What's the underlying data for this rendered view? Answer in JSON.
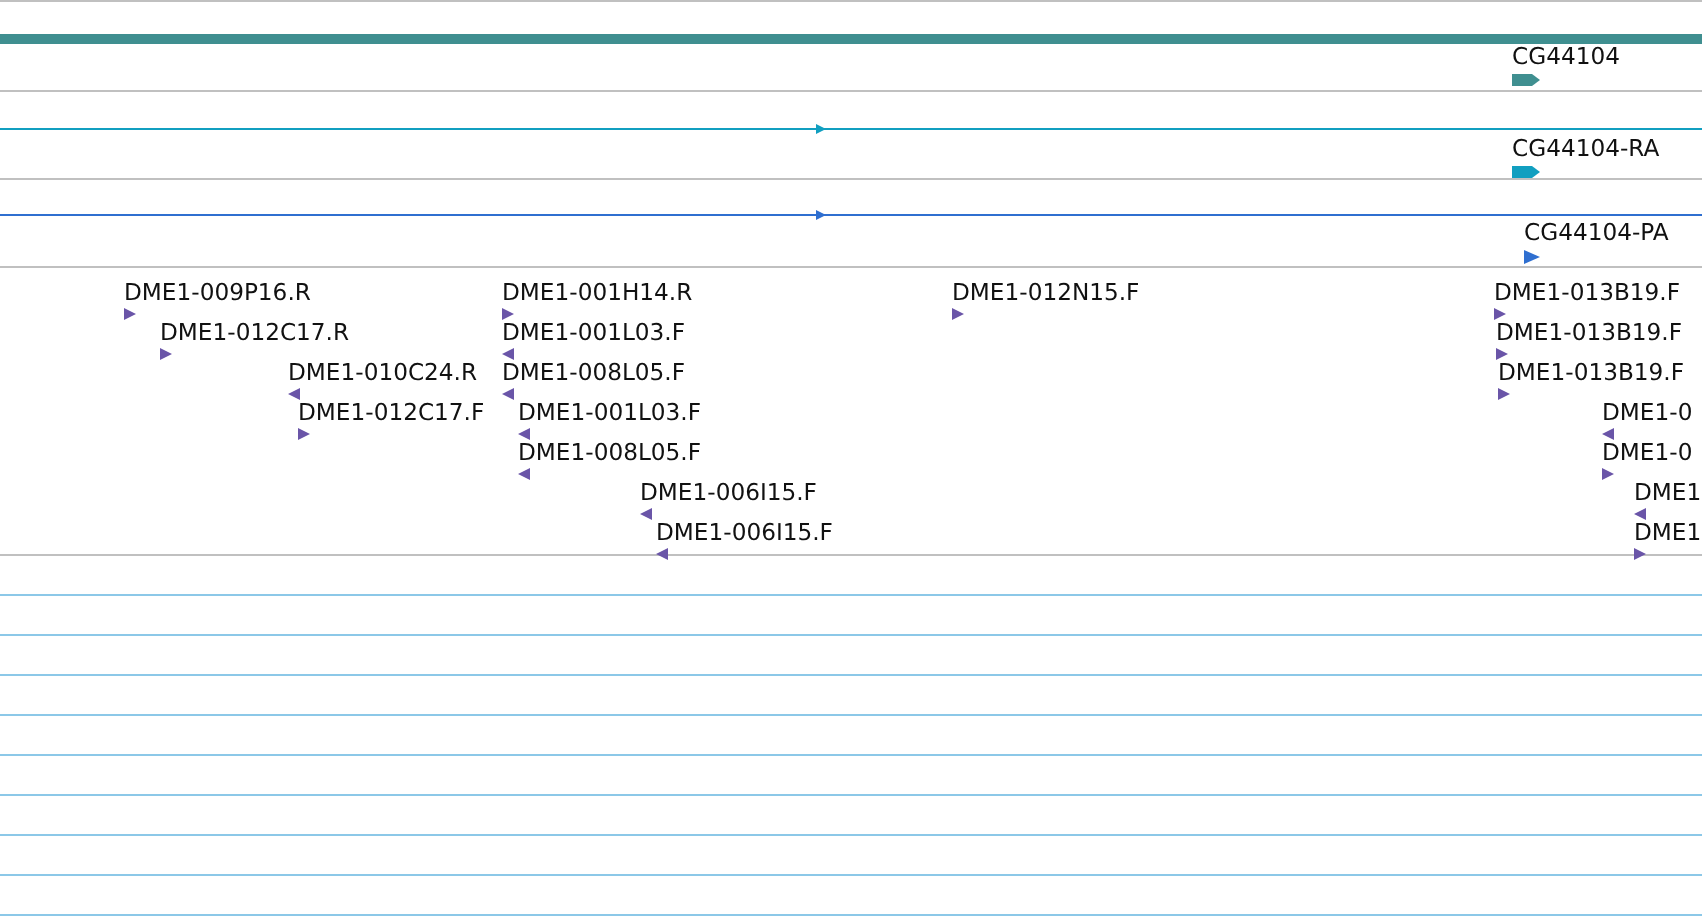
{
  "gene_tracks": [
    {
      "kind": "gene",
      "color": "#3f8f90",
      "label": "CG44104",
      "reverse": false
    },
    {
      "kind": "transcript",
      "color": "#119fc0",
      "label": "CG44104-RA",
      "reverse": false
    },
    {
      "kind": "protein",
      "color": "#2f6fd0",
      "label": "CG44104-PA",
      "reverse": false
    }
  ],
  "est_track": {
    "features": [
      {
        "label": "DME1-009P16.R",
        "reverse": false
      },
      {
        "label": "DME1-001H14.R",
        "reverse": false
      },
      {
        "label": "DME1-012N15.F",
        "reverse": false
      },
      {
        "label": "DME1-013B19.F",
        "reverse": false
      },
      {
        "label": "DME1-012C17.R",
        "reverse": false
      },
      {
        "label": "DME1-001L03.F",
        "reverse": true
      },
      {
        "label": "DME1-013B19.F",
        "reverse": false
      },
      {
        "label": "DME1-010C24.R",
        "reverse": true
      },
      {
        "label": "DME1-008L05.F",
        "reverse": true
      },
      {
        "label": "DME1-013B19.F",
        "reverse": false
      },
      {
        "label": "DME1-012C17.F",
        "reverse": false
      },
      {
        "label": "DME1-001L03.F",
        "reverse": true
      },
      {
        "label": "DME1-0",
        "reverse": true
      },
      {
        "label": "DME1-008L05.F",
        "reverse": true
      },
      {
        "label": "DME1-0",
        "reverse": false
      },
      {
        "label": "DME1-006I15.F",
        "reverse": true
      },
      {
        "label": "DME1",
        "reverse": true
      },
      {
        "label": "DME1-006I15.F",
        "reverse": true
      },
      {
        "label": "DME1",
        "reverse": false
      }
    ]
  }
}
